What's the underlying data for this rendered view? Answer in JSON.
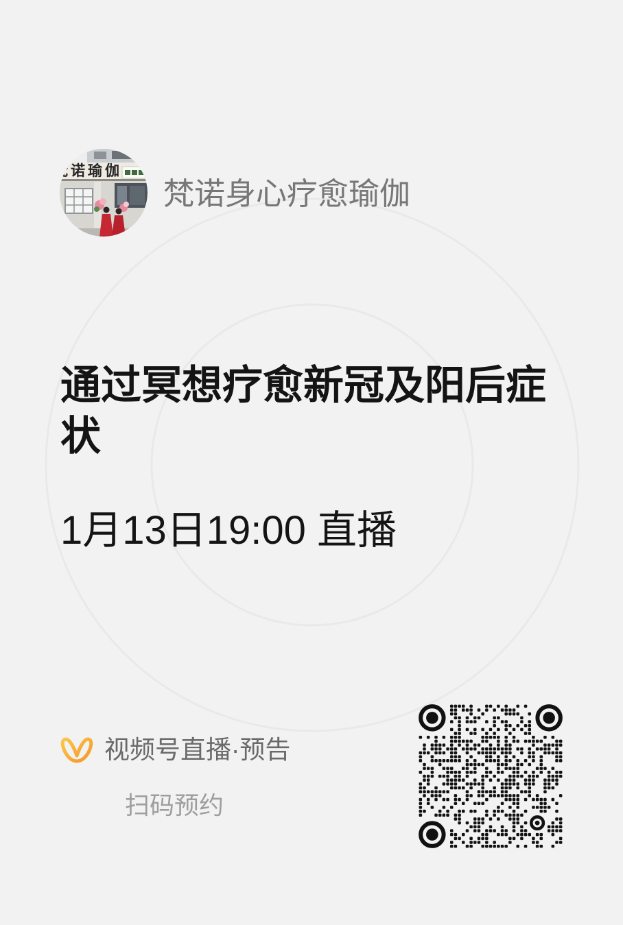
{
  "colors": {
    "background": "#f2f2f2",
    "title": "#141414",
    "account_name": "#777777",
    "brand_text": "#6a6a6a",
    "cta_text": "#9e9e9e",
    "brand_accent_start": "#fbc64b",
    "brand_accent_end": "#f5962b",
    "qr": "#111111"
  },
  "account": {
    "name": "梵诺身心疗愈瑜伽",
    "avatar": {
      "icon": "avatar-photo",
      "sign_text": "梵诺瑜伽"
    }
  },
  "live": {
    "title": "通过冥想疗愈新冠及阳后症状",
    "schedule": "1月13日19:00 直播"
  },
  "footer": {
    "brand_icon": "wechat-channels-logo-icon",
    "brand_text": "视频号直播·预告",
    "cta_text": "扫码预约",
    "qr_icon": "qr-code"
  }
}
